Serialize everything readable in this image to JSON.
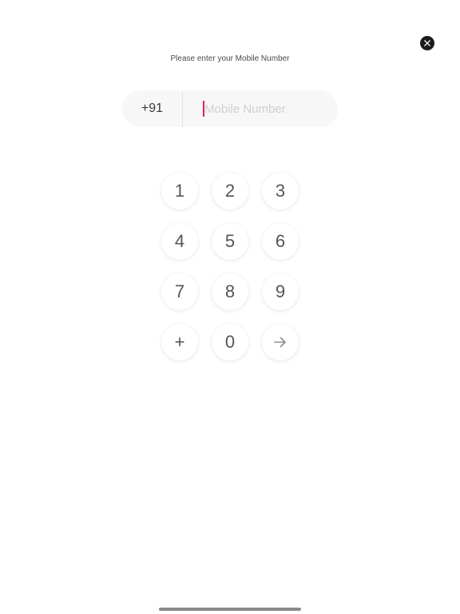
{
  "header": {
    "close_icon": "close-icon",
    "prompt": "Please enter your Mobile Number"
  },
  "phone": {
    "country_code": "+91",
    "number_value": "",
    "number_placeholder": "Mobile Number"
  },
  "keypad": {
    "keys": [
      "1",
      "2",
      "3",
      "4",
      "5",
      "6",
      "7",
      "8",
      "9",
      "+",
      "0"
    ],
    "submit_icon": "arrow-right-icon"
  },
  "colors": {
    "caret": "#e0245e",
    "close_button": "#1c1c1e",
    "field_background": "#f7f7f8"
  }
}
